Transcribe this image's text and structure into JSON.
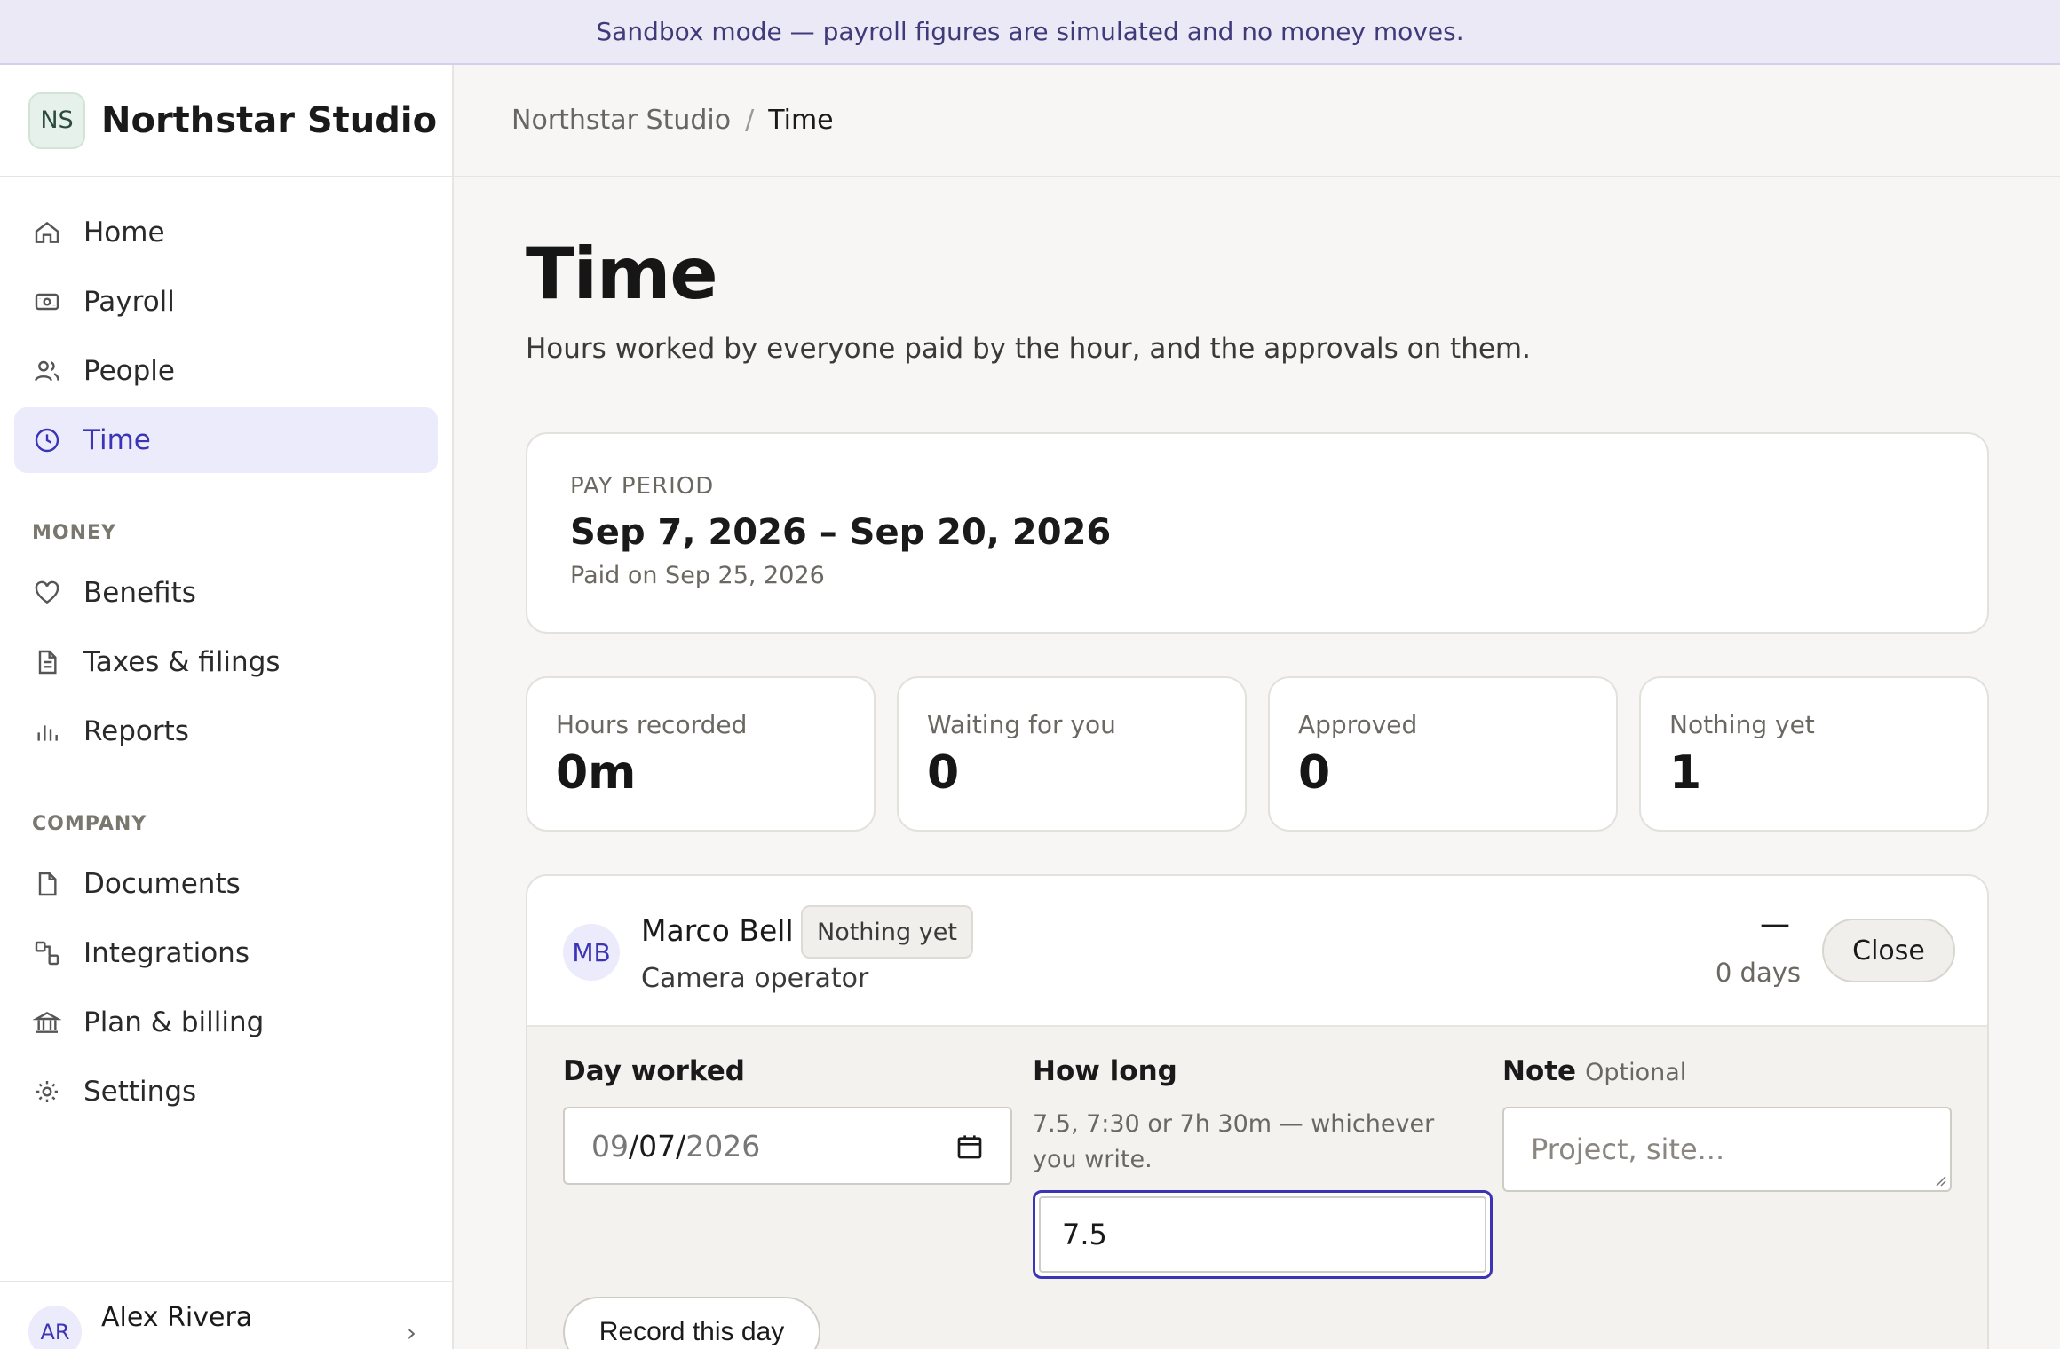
{
  "banner": {
    "text": "Sandbox mode — payroll figures are simulated and no money moves."
  },
  "brand": {
    "initials": "NS",
    "name": "Northstar Studio"
  },
  "nav": {
    "items": [
      {
        "label": "Home",
        "icon": "home-icon"
      },
      {
        "label": "Payroll",
        "icon": "payroll-icon"
      },
      {
        "label": "People",
        "icon": "people-icon"
      },
      {
        "label": "Time",
        "icon": "clock-icon",
        "active": true
      }
    ],
    "money_section": "MONEY",
    "money_items": [
      {
        "label": "Benefits",
        "icon": "heart-icon"
      },
      {
        "label": "Taxes & filings",
        "icon": "document-icon"
      },
      {
        "label": "Reports",
        "icon": "bar-chart-icon"
      }
    ],
    "company_section": "COMPANY",
    "company_items": [
      {
        "label": "Documents",
        "icon": "file-icon"
      },
      {
        "label": "Integrations",
        "icon": "integrations-icon"
      },
      {
        "label": "Plan & billing",
        "icon": "bank-icon"
      },
      {
        "label": "Settings",
        "icon": "gear-icon"
      }
    ]
  },
  "user": {
    "initials": "AR",
    "name": "Alex Rivera"
  },
  "breadcrumb": {
    "parent": "Northstar Studio",
    "separator": "/",
    "current": "Time"
  },
  "page": {
    "title": "Time",
    "subtitle": "Hours worked by everyone paid by the hour, and the approvals on them."
  },
  "period": {
    "label": "PAY PERIOD",
    "range": "Sep 7, 2026 – Sep 20, 2026",
    "paid_on": "Paid on Sep 25, 2026"
  },
  "stats": [
    {
      "label": "Hours recorded",
      "value": "0m"
    },
    {
      "label": "Waiting for you",
      "value": "0"
    },
    {
      "label": "Approved",
      "value": "0"
    },
    {
      "label": "Nothing yet",
      "value": "1"
    }
  ],
  "entry": {
    "initials": "MB",
    "name": "Marco Bell",
    "status": "Nothing yet",
    "role": "Camera operator",
    "hours": "—",
    "days": "0 days",
    "close_label": "Close",
    "day_label": "Day worked",
    "date_value": {
      "month": "09",
      "day": "07",
      "year": "2026",
      "sep": "/"
    },
    "how_long_label": "How long",
    "how_long_hint": "7.5, 7:30 or 7h 30m — whichever you write.",
    "how_long_value": "7.5",
    "note_label": "Note",
    "note_optional": "Optional",
    "note_placeholder": "Project, site...",
    "record_label": "Record this day"
  },
  "colors": {
    "accent": "#3b34b6",
    "banner_bg": "#ebe9f5",
    "active_bg": "#ecebfb"
  }
}
